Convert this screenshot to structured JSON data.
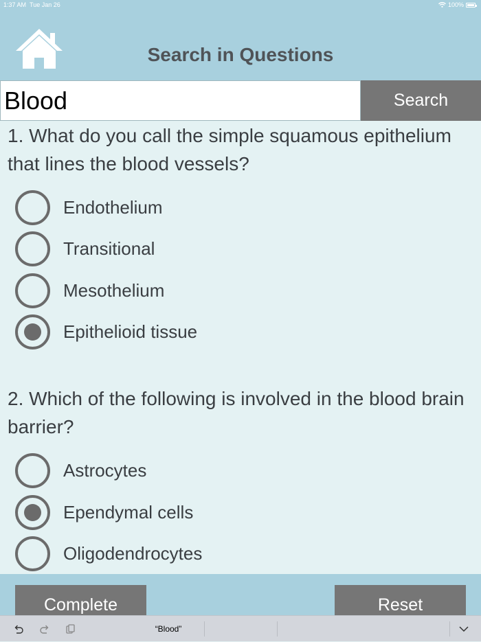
{
  "status": {
    "time": "1:37 AM",
    "date": "Tue Jan 26",
    "battery": "100%"
  },
  "header": {
    "title": "Search in Questions",
    "home_icon": "house-icon"
  },
  "search": {
    "value": "Blood",
    "button_label": "Search"
  },
  "questions": [
    {
      "text": "1. What do you call the simple squamous epithelium that lines the blood vessels?",
      "options": [
        {
          "label": "Endothelium",
          "selected": false
        },
        {
          "label": "Transitional",
          "selected": false
        },
        {
          "label": "Mesothelium",
          "selected": false
        },
        {
          "label": "Epithelioid tissue",
          "selected": true
        }
      ]
    },
    {
      "text": "2. Which of the following is involved in the blood brain barrier?",
      "options": [
        {
          "label": "Astrocytes",
          "selected": false
        },
        {
          "label": "Ependymal cells",
          "selected": true
        },
        {
          "label": "Oligodendrocytes",
          "selected": false
        }
      ]
    }
  ],
  "footer": {
    "complete_label": "Complete",
    "reset_label": "Reset"
  },
  "keyboard_bar": {
    "suggestion": "“Blood”"
  },
  "colors": {
    "accent": "#a8d0de",
    "background": "#e4f2f3",
    "button": "#767676",
    "radio": "#6b6b6b"
  }
}
